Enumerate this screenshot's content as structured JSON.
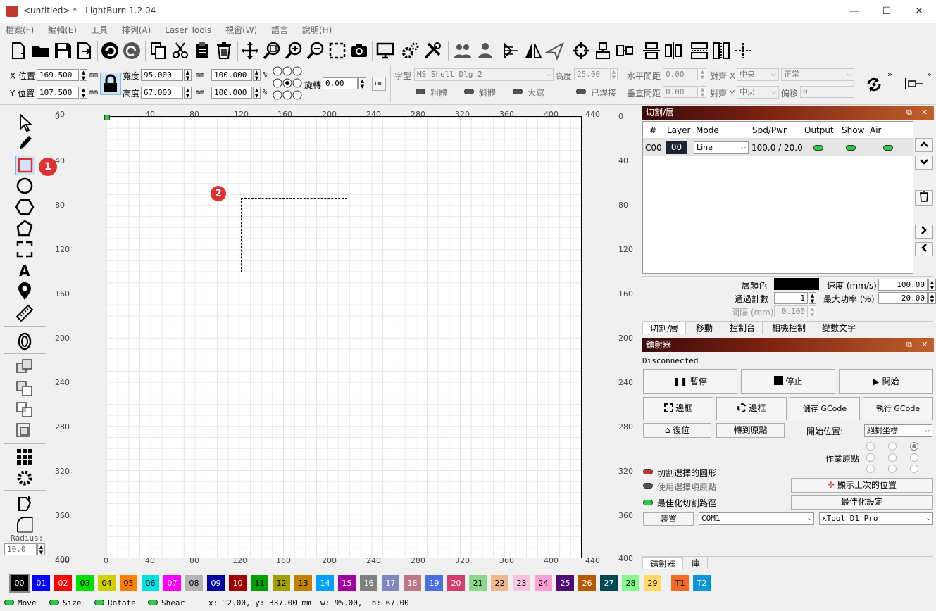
{
  "window": {
    "title": "<untitled> * - LightBurn 1.2.04",
    "minimize": "—",
    "maximize": "☐",
    "close": "✕"
  },
  "menu": [
    "檔案(F)",
    "編輯(E)",
    "工具",
    "排列(A)",
    "Laser Tools",
    "視窗(W)",
    "語言",
    "說明(H)"
  ],
  "props": {
    "x_label": "X 位置",
    "x_value": "169.500",
    "y_label": "Y 位置",
    "y_value": "107.500",
    "unit_mm": "mm",
    "width_label": "寬度",
    "width_value": "95.000",
    "height_label": "高度",
    "height_value": "67.000",
    "scale_w": "100.000",
    "scale_h": "100.000",
    "pct": "%",
    "rotate_label": "旋轉",
    "rotate_value": "0.00",
    "rotate_unit": "mm",
    "font_label": "字型",
    "font_value": "MS Shell Dlg 2",
    "fheight_label": "高度",
    "fheight_value": "25.00",
    "hspace_label": "水平間距",
    "hspace_value": "0.00",
    "align_x_label": "對齊 X",
    "align_x_value": "中央",
    "style_value": "正常",
    "vspace_label": "垂直間距",
    "vspace_value": "0.00",
    "align_y_label": "對齊 Y",
    "align_y_value": "中央",
    "offset_label": "偏移",
    "offset_value": "0",
    "bold": "粗體",
    "italic": "斜體",
    "upper": "大寫",
    "welded": "已焊接"
  },
  "left_tools": {
    "radius_label": "Radius:",
    "radius_value": "10.0"
  },
  "rulers": {
    "top": [
      "40",
      "40",
      "80",
      "120",
      "160",
      "200",
      "240",
      "280",
      "320",
      "360",
      "400",
      "440"
    ],
    "bottom": [
      "400",
      "0",
      "40",
      "80",
      "120",
      "160",
      "200",
      "240",
      "280",
      "320",
      "360",
      "400",
      "440"
    ],
    "left": [
      "0",
      "40",
      "80",
      "120",
      "160",
      "200",
      "240",
      "280",
      "320",
      "360",
      "400"
    ],
    "right": [
      "0",
      "40",
      "80",
      "120",
      "160",
      "200",
      "240",
      "280",
      "320",
      "360",
      "400"
    ]
  },
  "badges": {
    "one": "1",
    "two": "2"
  },
  "layers": {
    "title": "切割/層",
    "headers": [
      "#",
      "Layer",
      "Mode",
      "Spd/Pwr",
      "Output",
      "Show",
      "Air"
    ],
    "row": {
      "id": "C00",
      "layer": "00",
      "mode": "Line",
      "spdpwr": "100.0 / 20.0"
    },
    "color_label": "層顏色",
    "speed_label": "速度 (mm/s)",
    "speed_value": "100.00",
    "passes_label": "通過計數",
    "passes_value": "1",
    "power_label": "最大功率 (%)",
    "power_value": "20.00",
    "interval_label": "間隔 (mm)",
    "interval_value": "0.100",
    "tabs": [
      "切割/層",
      "移動",
      "控制台",
      "相機控制",
      "變數文字"
    ]
  },
  "laser": {
    "title": "鐳射器",
    "status": "Disconnected",
    "pause": "暫停",
    "stop": "停止",
    "start": "開始",
    "frame1": "邊框",
    "frame2": "邊框",
    "save_gcode": "儲存 GCode",
    "run_gcode": "執行 GCode",
    "home": "復位",
    "goto_origin": "轉到原點",
    "start_from_label": "開始位置:",
    "start_from_value": "絕對坐標",
    "job_origin": "作業原點",
    "cut_selected": "切割選擇的圖形",
    "use_selection_origin": "使用選擇項原點",
    "optimize_path": "最佳化切割路徑",
    "show_last": "顯示上次的位置",
    "optimize_settings": "最佳化設定",
    "devices": "裝置",
    "port": "COM1",
    "machine": "xTool D1 Pro",
    "tabs": [
      "鐳射器",
      "庫"
    ]
  },
  "palette": [
    {
      "n": "00",
      "c": "#000000",
      "t": "#ffffff"
    },
    {
      "n": "01",
      "c": "#0000ff",
      "t": "#ffffff"
    },
    {
      "n": "02",
      "c": "#ff0000",
      "t": "#ffffff"
    },
    {
      "n": "03",
      "c": "#00e000",
      "t": "#000000"
    },
    {
      "n": "04",
      "c": "#d0d000",
      "t": "#000000"
    },
    {
      "n": "05",
      "c": "#ff8000",
      "t": "#000000"
    },
    {
      "n": "06",
      "c": "#00e0e0",
      "t": "#000000"
    },
    {
      "n": "07",
      "c": "#ff00ff",
      "t": "#ffffff"
    },
    {
      "n": "08",
      "c": "#b4b4b4",
      "t": "#000000"
    },
    {
      "n": "09",
      "c": "#0000a0",
      "t": "#ffffff"
    },
    {
      "n": "10",
      "c": "#a00000",
      "t": "#ffffff"
    },
    {
      "n": "11",
      "c": "#00a000",
      "t": "#000000"
    },
    {
      "n": "12",
      "c": "#a0a000",
      "t": "#000000"
    },
    {
      "n": "13",
      "c": "#c08000",
      "t": "#000000"
    },
    {
      "n": "14",
      "c": "#00a0ff",
      "t": "#ffffff"
    },
    {
      "n": "15",
      "c": "#a000a0",
      "t": "#ffffff"
    },
    {
      "n": "16",
      "c": "#808080",
      "t": "#ffffff"
    },
    {
      "n": "17",
      "c": "#7d87b9",
      "t": "#ffffff"
    },
    {
      "n": "18",
      "c": "#bb7784",
      "t": "#ffffff"
    },
    {
      "n": "19",
      "c": "#4a6fe3",
      "t": "#ffffff"
    },
    {
      "n": "20",
      "c": "#d33f6a",
      "t": "#ffffff"
    },
    {
      "n": "21",
      "c": "#8cd78c",
      "t": "#000000"
    },
    {
      "n": "22",
      "c": "#f0b98d",
      "t": "#000000"
    },
    {
      "n": "23",
      "c": "#f6c4e1",
      "t": "#000000"
    },
    {
      "n": "24",
      "c": "#fa9ed4",
      "t": "#000000"
    },
    {
      "n": "25",
      "c": "#500a78",
      "t": "#ffffff"
    },
    {
      "n": "26",
      "c": "#b45a00",
      "t": "#ffffff"
    },
    {
      "n": "27",
      "c": "#004754",
      "t": "#ffffff"
    },
    {
      "n": "28",
      "c": "#86fa88",
      "t": "#000000"
    },
    {
      "n": "29",
      "c": "#ffdb66",
      "t": "#000000"
    },
    {
      "n": "T1",
      "c": "#f36926",
      "t": "#000000"
    },
    {
      "n": "T2",
      "c": "#0c96d9",
      "t": "#ffffff"
    }
  ],
  "status": {
    "move": "Move",
    "size": "Size",
    "rotate": "Rotate",
    "shear": "Shear",
    "coords": "x: 12.00, y: 337.00 mm  w: 95.00,  h: 67.00"
  }
}
